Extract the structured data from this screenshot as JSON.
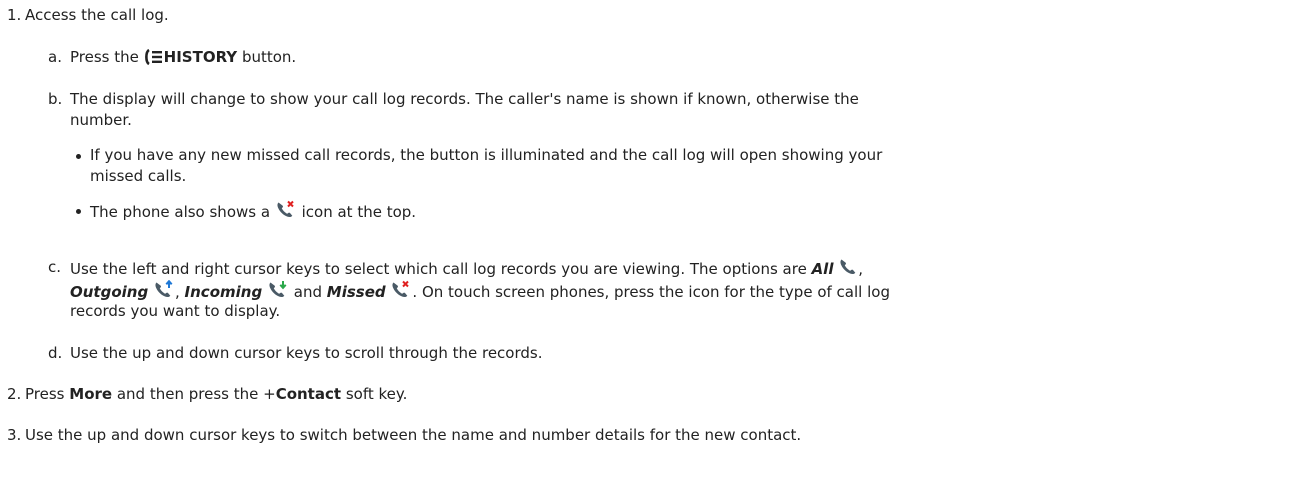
{
  "step1": {
    "num": "1.",
    "text": "Access the call log.",
    "a": {
      "num": "a.",
      "pre": "Press the",
      "button": "HISTORY",
      "post": "button."
    },
    "b": {
      "num": "b.",
      "line1": "The display will change to show your call log records. The caller's name is shown if known, otherwise the",
      "line2": "number.",
      "bullet1_line1": "If you have any new missed call records, the button is illuminated and the call log will open showing your",
      "bullet1_line2": "missed calls.",
      "bullet2_pre": "The phone also shows a",
      "bullet2_post": "icon at the top."
    },
    "c": {
      "num": "c.",
      "line1_pre": "Use the left and right cursor keys to select which call log records you are viewing. The options are",
      "all": "All",
      "comma": ",",
      "outgoing": "Outgoing",
      "sep": ",",
      "incoming": "Incoming",
      "and": "and",
      "missed": "Missed",
      "line2_post": ". On touch screen phones, press the icon for the type of call log",
      "line3": "records you want to display."
    },
    "d": {
      "num": "d.",
      "text": "Use the up and down cursor keys to scroll through the records."
    }
  },
  "step2": {
    "num": "2.",
    "pre": "Press",
    "more": "More",
    "mid": "and then press the +",
    "contact": "Contact",
    "post": "soft key."
  },
  "step3": {
    "num": "3.",
    "text": "Use the up and down cursor keys to switch between the name and number details for the new contact."
  },
  "icons": {
    "history": "history-icon",
    "missed_call": "missed-call-icon",
    "all_calls": "all-calls-icon",
    "outgoing_call": "outgoing-call-icon",
    "incoming_call": "incoming-call-icon",
    "colors": {
      "arrow_up": "#1e78d6",
      "arrow_down": "#2aa84a",
      "cross": "#e02020",
      "handset": "#4a5a66"
    }
  }
}
